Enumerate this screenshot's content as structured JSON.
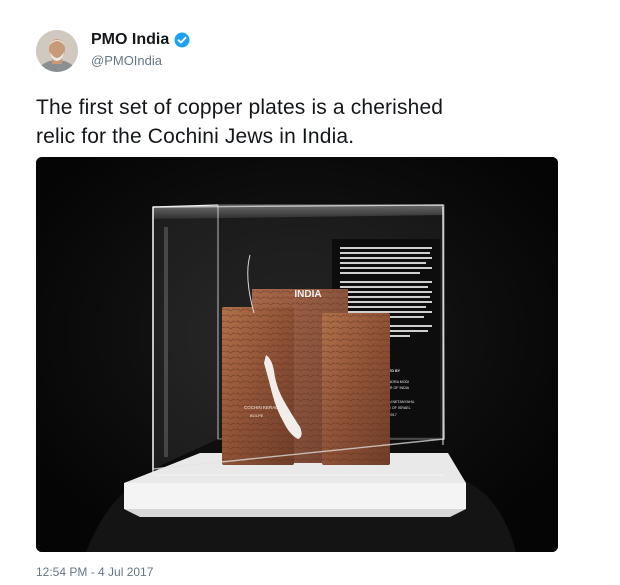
{
  "author": {
    "name": "PMO India",
    "handle": "@PMOIndia",
    "verified": true,
    "verified_color": "#1da1f2"
  },
  "tweet": {
    "text_line1": "The first set of copper plates is a cherished",
    "text_line2": "relic for the Cochini Jews in India.",
    "timestamp": "12:54 PM - 4 Jul 2017"
  },
  "media": {
    "plaque": {
      "india_label": "INDIA",
      "cochin_label": "COCHIN KERALA",
      "cochin_sub": "BOLPE",
      "presented_by": "PRESENTED BY",
      "presenter_name": "H.E. SRI. NARENDRA MODI",
      "presenter_title": "PRIME MINISTER OF INDIA",
      "to_word": "TO",
      "recipient_name": "H.E. MR. BENJAMIN NETANYAHU",
      "recipient_title": "PRIME MINISTER OF ISRAEL",
      "date": "JULY 4, 2017"
    }
  }
}
